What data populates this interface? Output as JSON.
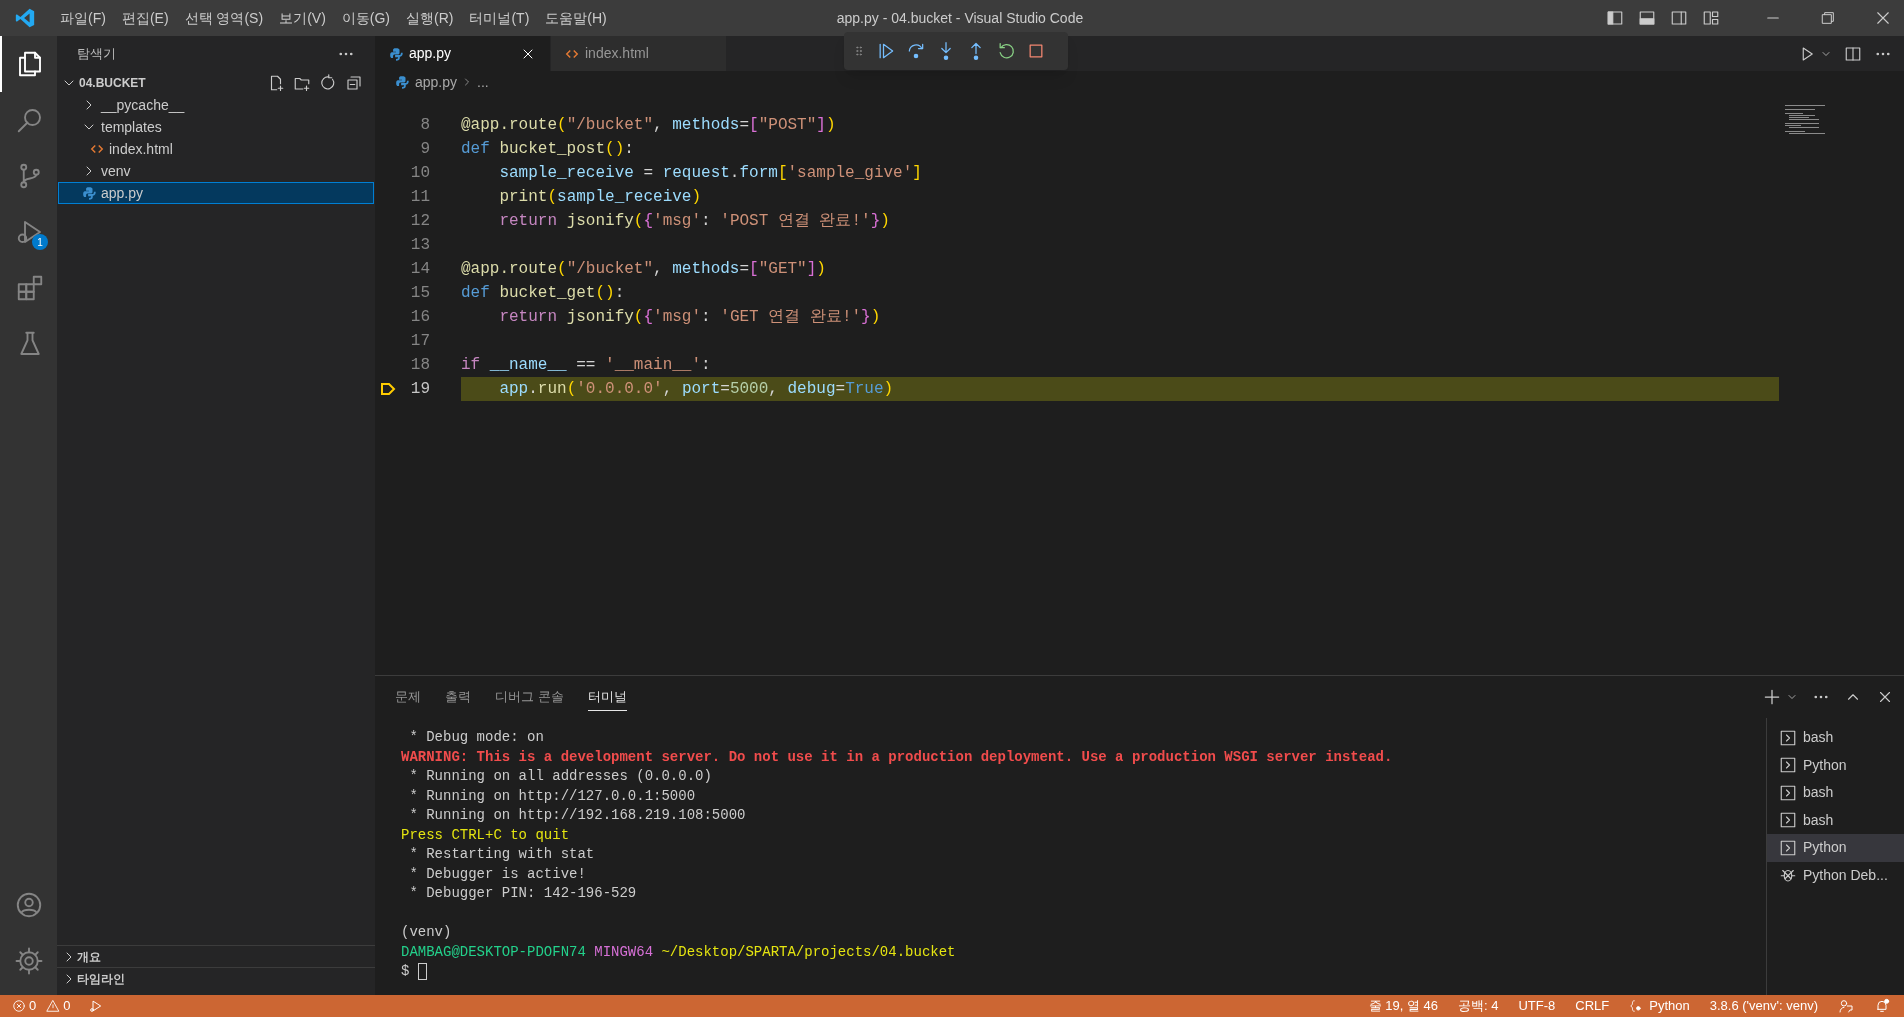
{
  "title_bar": {
    "menu": [
      "파일(F)",
      "편집(E)",
      "선택 영역(S)",
      "보기(V)",
      "이동(G)",
      "실행(R)",
      "터미널(T)",
      "도움말(H)"
    ],
    "title": "app.py - 04.bucket - Visual Studio Code"
  },
  "activity_bar": {
    "items": [
      {
        "kind": "explorer",
        "selected": true
      },
      {
        "kind": "search",
        "selected": false
      },
      {
        "kind": "source-control",
        "selected": false
      },
      {
        "kind": "run-debug",
        "selected": false,
        "badge": "1"
      },
      {
        "kind": "extensions",
        "selected": false
      },
      {
        "kind": "testing",
        "selected": false
      }
    ],
    "bottom": [
      {
        "kind": "account"
      },
      {
        "kind": "settings"
      }
    ]
  },
  "sidebar": {
    "title": "탐색기",
    "folder": {
      "label": "04.BUCKET",
      "expanded": true
    },
    "tree": [
      {
        "label": "__pycache__",
        "kind": "folder",
        "expanded": false,
        "selected": false
      },
      {
        "label": "templates",
        "kind": "folder",
        "expanded": true,
        "selected": false,
        "children": [
          {
            "label": "index.html",
            "kind": "html",
            "selected": false
          }
        ]
      },
      {
        "label": "venv",
        "kind": "folder",
        "expanded": false,
        "selected": false
      },
      {
        "label": "app.py",
        "kind": "python",
        "selected": true
      }
    ],
    "sections": [
      {
        "label": "개요",
        "expanded": false
      },
      {
        "label": "타임라인",
        "expanded": false
      }
    ]
  },
  "tabs": [
    {
      "label": "app.py",
      "kind": "python",
      "selected": true
    },
    {
      "label": "index.html",
      "kind": "html",
      "selected": false
    }
  ],
  "breadcrumb": [
    "app.py",
    "..."
  ],
  "code": [
    {
      "number": "8",
      "current": false,
      "tokens": [
        {
          "kind": "fn",
          "text": "@app.route"
        },
        {
          "kind": "b1",
          "text": "("
        },
        {
          "kind": "str",
          "text": "\"/bucket\""
        },
        {
          "kind": "plain",
          "text": ", "
        },
        {
          "kind": "var",
          "text": "methods"
        },
        {
          "kind": "plain",
          "text": "="
        },
        {
          "kind": "b2",
          "text": "["
        },
        {
          "kind": "str",
          "text": "\"POST\""
        },
        {
          "kind": "b2",
          "text": "]"
        },
        {
          "kind": "b1",
          "text": ")"
        }
      ]
    },
    {
      "number": "9",
      "current": false,
      "tokens": [
        {
          "kind": "def",
          "text": "def "
        },
        {
          "kind": "fn",
          "text": "bucket_post"
        },
        {
          "kind": "b1",
          "text": "()"
        },
        {
          "kind": "plain",
          "text": ":"
        }
      ]
    },
    {
      "number": "10",
      "current": false,
      "tokens": [
        {
          "kind": "var",
          "text": "    sample_receive"
        },
        {
          "kind": "plain",
          "text": " = "
        },
        {
          "kind": "var",
          "text": "request"
        },
        {
          "kind": "plain",
          "text": "."
        },
        {
          "kind": "var",
          "text": "form"
        },
        {
          "kind": "b1",
          "text": "["
        },
        {
          "kind": "str",
          "text": "'sample_give'"
        },
        {
          "kind": "b1",
          "text": "]"
        }
      ]
    },
    {
      "number": "11",
      "current": false,
      "tokens": [
        {
          "kind": "fn",
          "text": "    print"
        },
        {
          "kind": "b1",
          "text": "("
        },
        {
          "kind": "var",
          "text": "sample_receive"
        },
        {
          "kind": "b1",
          "text": ")"
        }
      ]
    },
    {
      "number": "12",
      "current": false,
      "tokens": [
        {
          "kind": "ctrl",
          "text": "    return "
        },
        {
          "kind": "fn",
          "text": "jsonify"
        },
        {
          "kind": "b1",
          "text": "("
        },
        {
          "kind": "b2",
          "text": "{"
        },
        {
          "kind": "str",
          "text": "'msg'"
        },
        {
          "kind": "plain",
          "text": ": "
        },
        {
          "kind": "str",
          "text": "'POST 연결 완료!'"
        },
        {
          "kind": "b2",
          "text": "}"
        },
        {
          "kind": "b1",
          "text": ")"
        }
      ]
    },
    {
      "number": "13",
      "current": false
    },
    {
      "number": "14",
      "current": false,
      "tokens": [
        {
          "kind": "fn",
          "text": "@app.route"
        },
        {
          "kind": "b1",
          "text": "("
        },
        {
          "kind": "str",
          "text": "\"/bucket\""
        },
        {
          "kind": "plain",
          "text": ", "
        },
        {
          "kind": "var",
          "text": "methods"
        },
        {
          "kind": "plain",
          "text": "="
        },
        {
          "kind": "b2",
          "text": "["
        },
        {
          "kind": "str",
          "text": "\"GET\""
        },
        {
          "kind": "b2",
          "text": "]"
        },
        {
          "kind": "b1",
          "text": ")"
        }
      ]
    },
    {
      "number": "15",
      "current": false,
      "tokens": [
        {
          "kind": "def",
          "text": "def "
        },
        {
          "kind": "fn",
          "text": "bucket_get"
        },
        {
          "kind": "b1",
          "text": "()"
        },
        {
          "kind": "plain",
          "text": ":"
        }
      ]
    },
    {
      "number": "16",
      "current": false,
      "tokens": [
        {
          "kind": "ctrl",
          "text": "    return "
        },
        {
          "kind": "fn",
          "text": "jsonify"
        },
        {
          "kind": "b1",
          "text": "("
        },
        {
          "kind": "b2",
          "text": "{"
        },
        {
          "kind": "str",
          "text": "'msg'"
        },
        {
          "kind": "plain",
          "text": ": "
        },
        {
          "kind": "str",
          "text": "'GET 연결 완료!'"
        },
        {
          "kind": "b2",
          "text": "}"
        },
        {
          "kind": "b1",
          "text": ")"
        }
      ]
    },
    {
      "number": "17",
      "current": false
    },
    {
      "number": "18",
      "current": false,
      "tokens": [
        {
          "kind": "ctrl",
          "text": "if "
        },
        {
          "kind": "var",
          "text": "__name__"
        },
        {
          "kind": "plain",
          "text": " == "
        },
        {
          "kind": "str",
          "text": "'__main__'"
        },
        {
          "kind": "plain",
          "text": ":"
        }
      ]
    },
    {
      "number": "19",
      "current": true,
      "tokens": [
        {
          "kind": "var",
          "text": "    app"
        },
        {
          "kind": "plain",
          "text": "."
        },
        {
          "kind": "fn",
          "text": "run"
        },
        {
          "kind": "b1",
          "text": "("
        },
        {
          "kind": "str",
          "text": "'0.0.0.0'"
        },
        {
          "kind": "plain",
          "text": ", "
        },
        {
          "kind": "var",
          "text": "port"
        },
        {
          "kind": "plain",
          "text": "="
        },
        {
          "kind": "num",
          "text": "5000"
        },
        {
          "kind": "plain",
          "text": ", "
        },
        {
          "kind": "var",
          "text": "debug"
        },
        {
          "kind": "plain",
          "text": "="
        },
        {
          "kind": "def",
          "text": "True"
        },
        {
          "kind": "b1",
          "text": ")"
        }
      ]
    }
  ],
  "panel": {
    "tabs": [
      {
        "label": "문제",
        "selected": false
      },
      {
        "label": "출력",
        "selected": false
      },
      {
        "label": "디버그 콘솔",
        "selected": false
      },
      {
        "label": "터미널",
        "selected": true
      }
    ],
    "terminal": [
      {
        "kind": "plain",
        "segments": [
          {
            "kind": "plain",
            "text": " * Debug mode: on"
          }
        ]
      },
      {
        "kind": "plain",
        "segments": [
          {
            "kind": "error",
            "text": "WARNING: This is a development server. Do not use it in a production deployment. Use a production WSGI server instead."
          }
        ]
      },
      {
        "kind": "plain",
        "segments": [
          {
            "kind": "plain",
            "text": " * Running on all addresses (0.0.0.0)"
          }
        ]
      },
      {
        "kind": "plain",
        "segments": [
          {
            "kind": "plain",
            "text": " * Running on http://127.0.0.1:5000"
          }
        ]
      },
      {
        "kind": "plain",
        "segments": [
          {
            "kind": "plain",
            "text": " * Running on http://192.168.219.108:5000"
          }
        ]
      },
      {
        "kind": "plain",
        "segments": [
          {
            "kind": "yellow",
            "text": "Press CTRL+C to quit"
          }
        ]
      },
      {
        "kind": "plain",
        "segments": [
          {
            "kind": "plain",
            "text": " * Restarting with stat"
          }
        ]
      },
      {
        "kind": "plain",
        "segments": [
          {
            "kind": "plain",
            "text": " * Debugger is active!"
          }
        ]
      },
      {
        "kind": "plain",
        "segments": [
          {
            "kind": "plain",
            "text": " * Debugger PIN: 142-196-529"
          }
        ]
      },
      {
        "kind": "blank"
      },
      {
        "kind": "plain",
        "segments": [
          {
            "kind": "plain",
            "text": "(venv)"
          }
        ]
      },
      {
        "kind": "plain",
        "segments": [
          {
            "kind": "green",
            "text": "DAMBAG@DESKTOP-PDOFN74"
          },
          {
            "kind": "magenta",
            "text": "MINGW64"
          },
          {
            "kind": "yellow",
            "text": "~/Desktop/SPARTA/projects/04.bucket"
          }
        ]
      },
      {
        "kind": "prompt",
        "segments": [
          {
            "kind": "plain",
            "text": "$"
          }
        ]
      }
    ],
    "terminals": [
      {
        "label": "bash",
        "kind": "shell",
        "selected": false
      },
      {
        "label": "Python",
        "kind": "shell",
        "selected": false
      },
      {
        "label": "bash",
        "kind": "shell",
        "selected": false
      },
      {
        "label": "bash",
        "kind": "shell",
        "selected": false
      },
      {
        "label": "Python",
        "kind": "shell",
        "selected": true
      },
      {
        "label": "Python Deb...",
        "kind": "debug",
        "selected": false
      }
    ]
  },
  "status_bar": {
    "left": [
      {
        "kind": "errors",
        "text": "0"
      },
      {
        "kind": "warnings",
        "text": "0"
      },
      {
        "kind": "run"
      }
    ],
    "right": [
      {
        "kind": "text",
        "text": "줄 19, 열 46"
      },
      {
        "kind": "text",
        "text": "공백: 4"
      },
      {
        "kind": "text",
        "text": "UTF-8"
      },
      {
        "kind": "text",
        "text": "CRLF"
      },
      {
        "kind": "language",
        "text": "Python"
      },
      {
        "kind": "text",
        "text": "3.8.6 ('venv': venv)"
      },
      {
        "kind": "feedback"
      },
      {
        "kind": "bell"
      }
    ]
  }
}
